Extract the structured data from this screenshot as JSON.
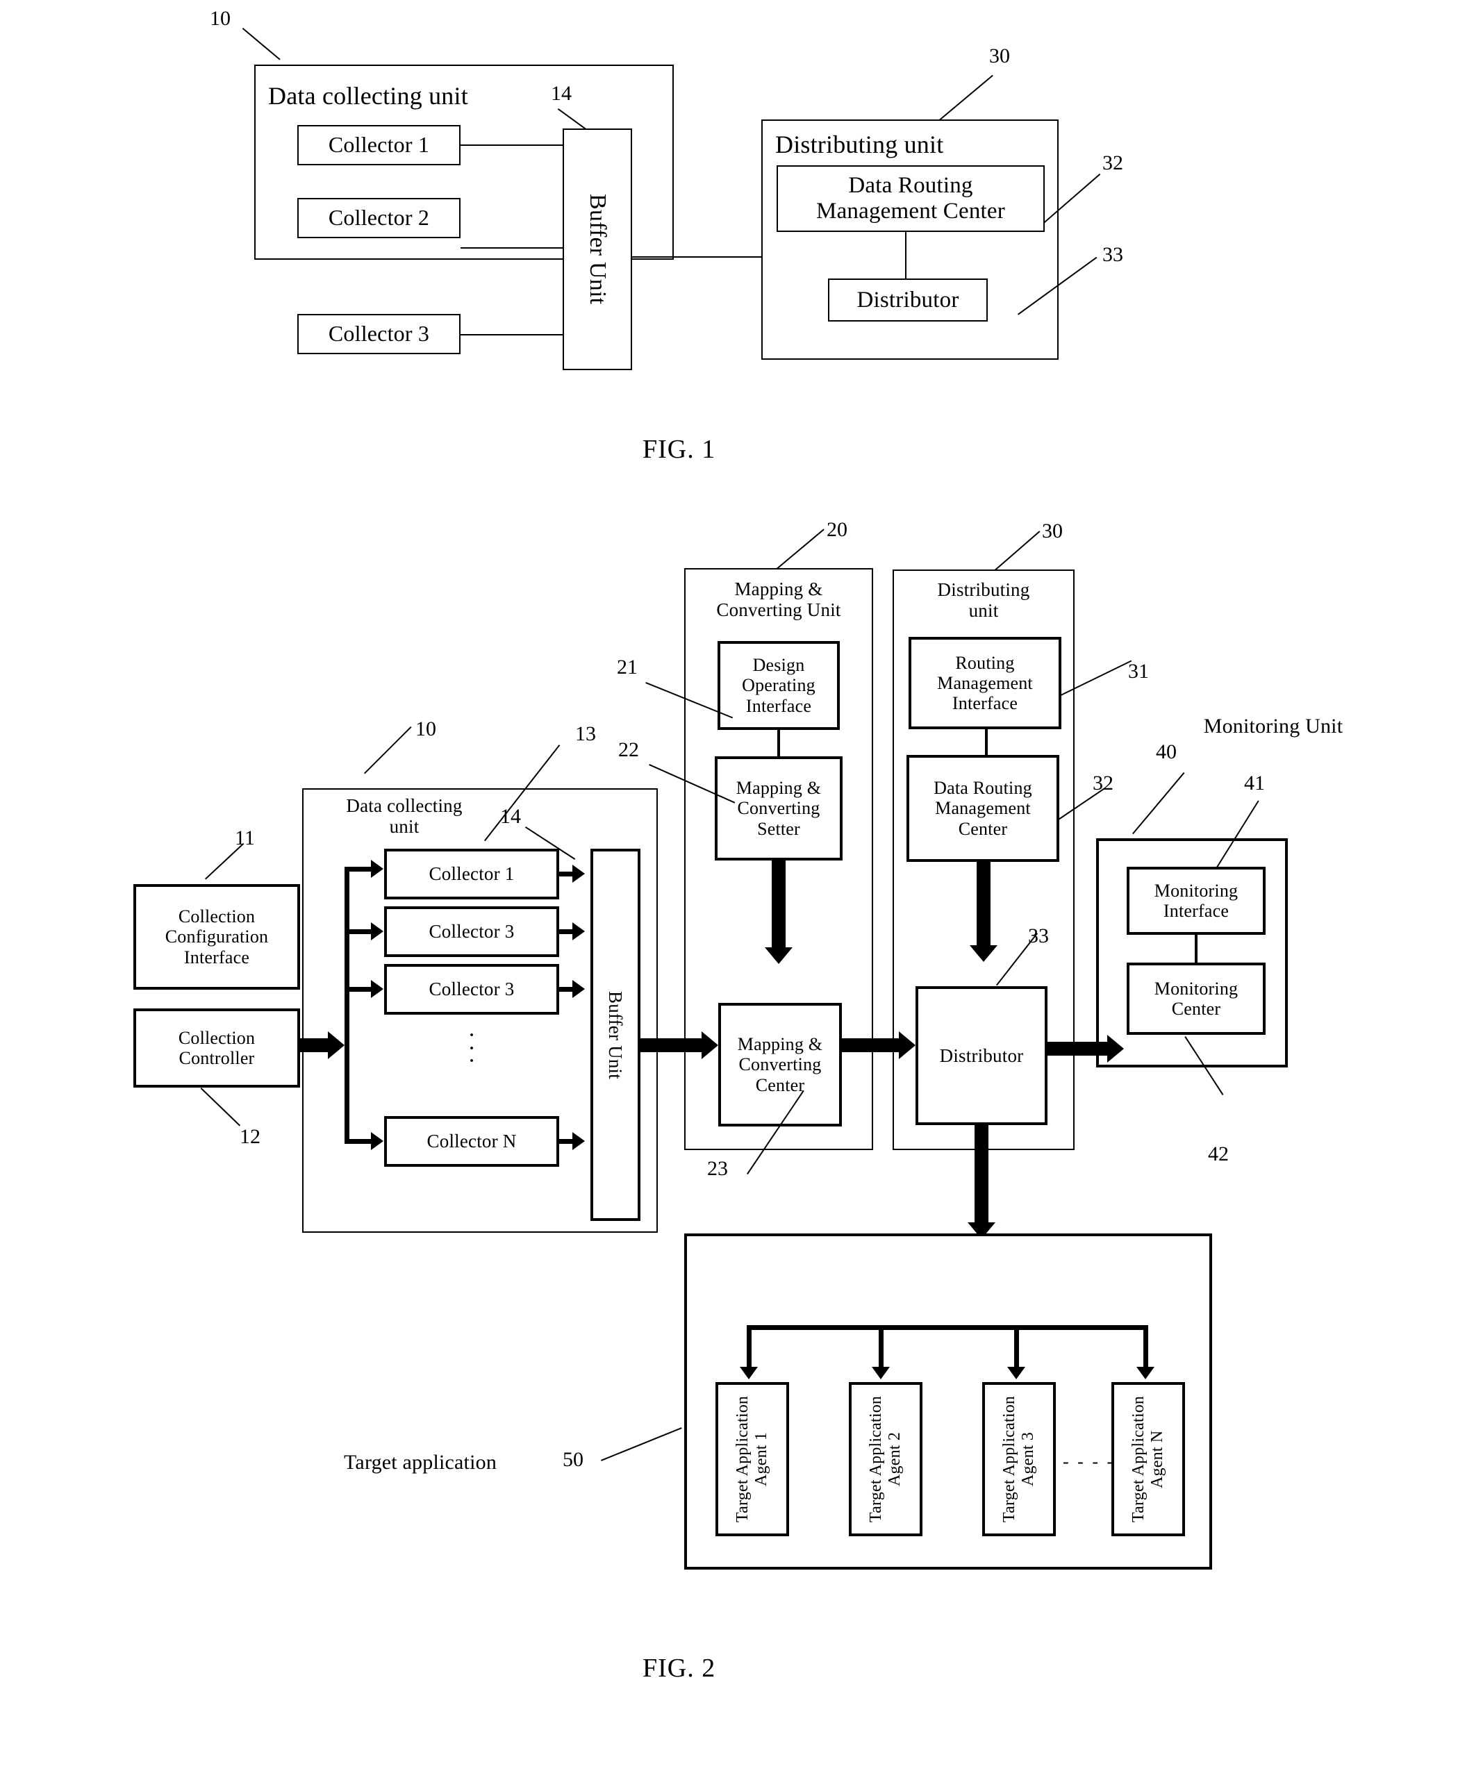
{
  "figure1": {
    "caption": "FIG. 1",
    "refs": {
      "data_collecting_unit": "10",
      "buffer_unit": "14",
      "distributing_unit": "30",
      "data_routing_management_center": "32",
      "distributor": "33"
    },
    "data_collecting_unit": {
      "title": "Data collecting unit",
      "collectors": [
        "Collector 1",
        "Collector 2",
        "Collector 3"
      ],
      "buffer_unit": "Buffer Unit"
    },
    "distributing_unit": {
      "title": "Distributing unit",
      "data_routing_management_center": "Data Routing\nManagement Center",
      "distributor": "Distributor"
    }
  },
  "figure2": {
    "caption": "FIG. 2",
    "refs": {
      "collection_configuration_interface": "11",
      "collection_controller": "12",
      "data_collecting_unit": "10",
      "collectors_group": "13",
      "buffer_unit": "14",
      "mapping_converting_unit": "20",
      "design_operating_interface": "21",
      "mapping_converting_setter": "22",
      "mapping_converting_center": "23",
      "distributing_unit": "30",
      "routing_management_interface": "31",
      "data_routing_management_center": "32",
      "distributor": "33",
      "monitoring_unit": "40",
      "monitoring_interface": "41",
      "monitoring_center": "42",
      "target_application": "50"
    },
    "collection_configuration_interface": "Collection\nConfiguration\nInterface",
    "collection_controller": "Collection\nController",
    "data_collecting_unit": {
      "title": "Data collecting\nunit",
      "collectors": [
        "Collector 1",
        "Collector 3",
        "Collector 3",
        "Collector N"
      ],
      "buffer_unit": "Buffer Unit",
      "ellipsis": "·\n·\n·"
    },
    "mapping_converting_unit": {
      "title": "Mapping &\nConverting Unit",
      "design_operating_interface": "Design\nOperating\nInterface",
      "mapping_converting_setter": "Mapping &\nConverting\nSetter",
      "mapping_converting_center": "Mapping &\nConverting\nCenter"
    },
    "distributing_unit": {
      "title": "Distributing\nunit",
      "routing_management_interface": "Routing\nManagement\nInterface",
      "data_routing_management_center": "Data Routing\nManagement\nCenter",
      "distributor": "Distributor"
    },
    "monitoring_unit": {
      "title": "Monitoring Unit",
      "monitoring_interface": "Monitoring\nInterface",
      "monitoring_center": "Monitoring\nCenter"
    },
    "target_application": {
      "label": "Target application",
      "agents": [
        "Target Application\nAgent 1",
        "Target Application\nAgent 2",
        "Target Application\nAgent 3",
        "Target Application\nAgent N"
      ],
      "ellipsis": "- - - -"
    }
  }
}
